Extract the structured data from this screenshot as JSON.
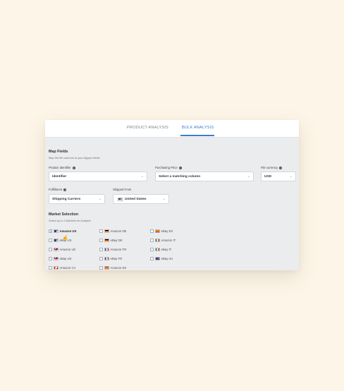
{
  "tabs": {
    "product": "PRODUCT ANALYSIS",
    "bulk": "BULK ANALYSIS"
  },
  "map_fields": {
    "title": "Map Fields",
    "subtitle": "Map the file columns to your Algopix fields",
    "product_identifier": {
      "label": "Product Identifier",
      "value": "Identifier"
    },
    "purchasing_price": {
      "label": "Purchasing Price",
      "value": "Select a matching column"
    },
    "file_currency": {
      "label": "File currency",
      "value": "USD"
    },
    "fulfillment": {
      "label": "Fulfillment",
      "value": "Shipping Carriers"
    },
    "shipped_from": {
      "label": "Shipped From",
      "value": "United States"
    }
  },
  "market_selection": {
    "title": "Market Selection",
    "subtitle": "Select up to 4 Markets for Analysis",
    "markets": [
      {
        "label": "Amazon US",
        "flag": "us",
        "checked": true
      },
      {
        "label": "eBay US",
        "flag": "us",
        "checked": false
      },
      {
        "label": "Amazon UK",
        "flag": "uk",
        "checked": false
      },
      {
        "label": "eBay UK",
        "flag": "uk",
        "checked": false
      },
      {
        "label": "Amazon CA",
        "flag": "ca",
        "checked": false
      },
      {
        "label": "Amazon DE",
        "flag": "de",
        "checked": false
      },
      {
        "label": "eBay DE",
        "flag": "de",
        "checked": false
      },
      {
        "label": "Amazon FR",
        "flag": "fr",
        "checked": false
      },
      {
        "label": "eBay FR",
        "flag": "fr",
        "checked": false
      },
      {
        "label": "Amazon ES",
        "flag": "es",
        "checked": false
      },
      {
        "label": "eBay ES",
        "flag": "es",
        "checked": false
      },
      {
        "label": "Amazon IT",
        "flag": "it",
        "checked": false
      },
      {
        "label": "eBay IT",
        "flag": "it",
        "checked": false
      },
      {
        "label": "eBay AU",
        "flag": "au",
        "checked": false
      }
    ]
  },
  "colors": {
    "accent": "#3a7bd5",
    "background": "#fdf6e8",
    "panel": "#ebeced"
  },
  "icons": {
    "info": "info-circle-icon",
    "chevron": "chevron-down-icon",
    "cursor": "mouse-pointer-icon"
  }
}
